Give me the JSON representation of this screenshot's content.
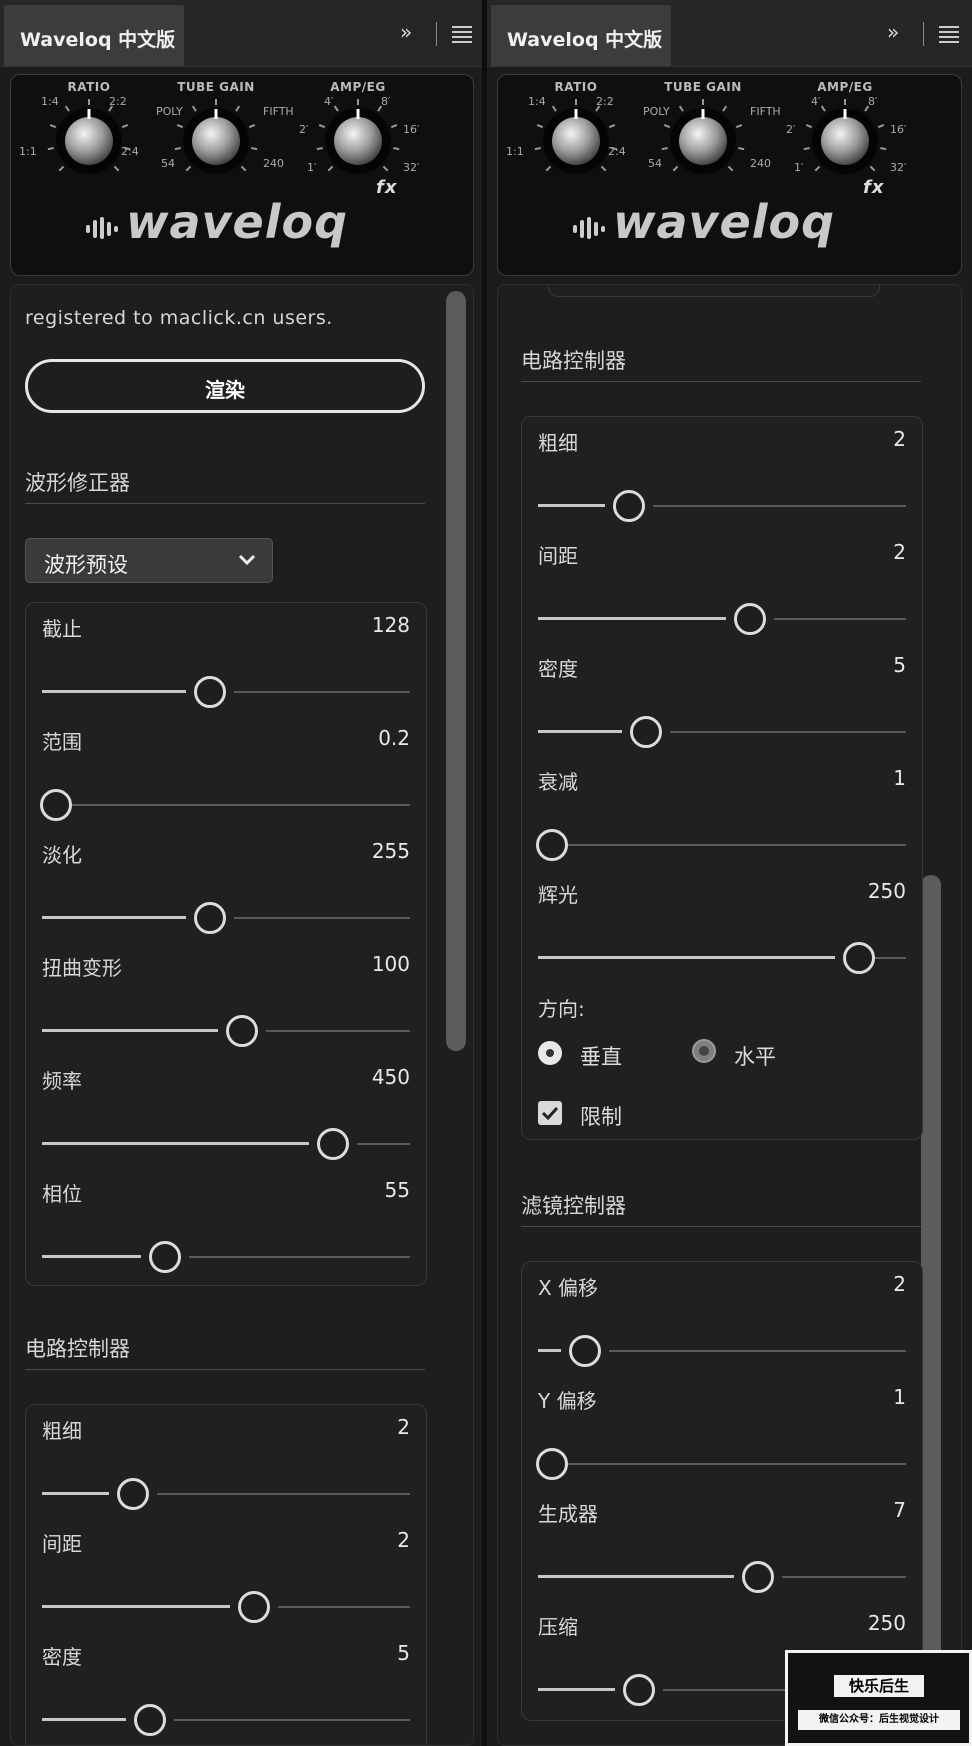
{
  "left": {
    "tab": {
      "title": "Waveloq 中文版",
      "expand": "»"
    },
    "header": {
      "knobs": [
        {
          "label": "RATIO",
          "ticks": [
            "1:4",
            "2:2",
            "1:1",
            "2:4"
          ]
        },
        {
          "label": "TUBE GAIN",
          "ticks": [
            "POLY",
            "FIFTH",
            "54",
            "240"
          ]
        },
        {
          "label": "AMP/EG",
          "ticks": [
            "4′",
            "8′",
            "2′",
            "16′",
            "1′",
            "32′"
          ]
        }
      ],
      "logo": "waveloq",
      "logo_fx": "fx"
    },
    "registered": "registered to maclick.cn users.",
    "render_label": "渲染",
    "waveform_section": "波形修正器",
    "preset_label": "波形预设",
    "waveform_sliders": [
      {
        "label": "截止",
        "value": "128",
        "pos": 0.5
      },
      {
        "label": "范围",
        "value": "0.2",
        "pos": 0.0
      },
      {
        "label": "淡化",
        "value": "255",
        "pos": 0.5
      },
      {
        "label": "扭曲变形",
        "value": "100",
        "pos": 0.595
      },
      {
        "label": "频率",
        "value": "450",
        "pos": 0.865
      },
      {
        "label": "相位",
        "value": "55",
        "pos": 0.365
      }
    ],
    "circuit_section": "电路控制器",
    "circuit_sliders": [
      {
        "label": "粗细",
        "value": "2",
        "pos": 0.27
      },
      {
        "label": "间距",
        "value": "2",
        "pos": 0.63
      },
      {
        "label": "密度",
        "value": "5",
        "pos": 0.32
      }
    ]
  },
  "right": {
    "tab": {
      "title": "Waveloq 中文版",
      "expand": "»"
    },
    "header": {
      "knobs": [
        {
          "label": "RATIO",
          "ticks": [
            "1:4",
            "2:2",
            "1:1",
            "2:4"
          ]
        },
        {
          "label": "TUBE GAIN",
          "ticks": [
            "POLY",
            "FIFTH",
            "54",
            "240"
          ]
        },
        {
          "label": "AMP/EG",
          "ticks": [
            "4′",
            "8′",
            "2′",
            "16′",
            "1′",
            "32′"
          ]
        }
      ],
      "logo": "waveloq",
      "logo_fx": "fx"
    },
    "circuit_section": "电路控制器",
    "circuit_sliders": [
      {
        "label": "粗细",
        "value": "2",
        "pos": 0.27
      },
      {
        "label": "间距",
        "value": "2",
        "pos": 0.63
      },
      {
        "label": "密度",
        "value": "5",
        "pos": 0.32
      },
      {
        "label": "衰减",
        "value": "1",
        "pos": 0.0
      },
      {
        "label": "辉光",
        "value": "250",
        "pos": 0.955
      }
    ],
    "direction_label": "方向:",
    "direction_options": [
      "垂直",
      "水平"
    ],
    "direction_selected": "垂直",
    "limit_label": "限制",
    "limit_checked": true,
    "filter_section": "滤镜控制器",
    "filter_sliders": [
      {
        "label": "X 偏移",
        "value": "2",
        "pos": 0.14
      },
      {
        "label": "Y 偏移",
        "value": "1",
        "pos": 0.0
      },
      {
        "label": "生成器",
        "value": "7",
        "pos": 0.655
      },
      {
        "label": "压缩",
        "value": "250",
        "pos": 0.3
      }
    ]
  },
  "watermark": {
    "title": "快乐后生",
    "subtitle": "微信公众号：后生视觉设计"
  }
}
